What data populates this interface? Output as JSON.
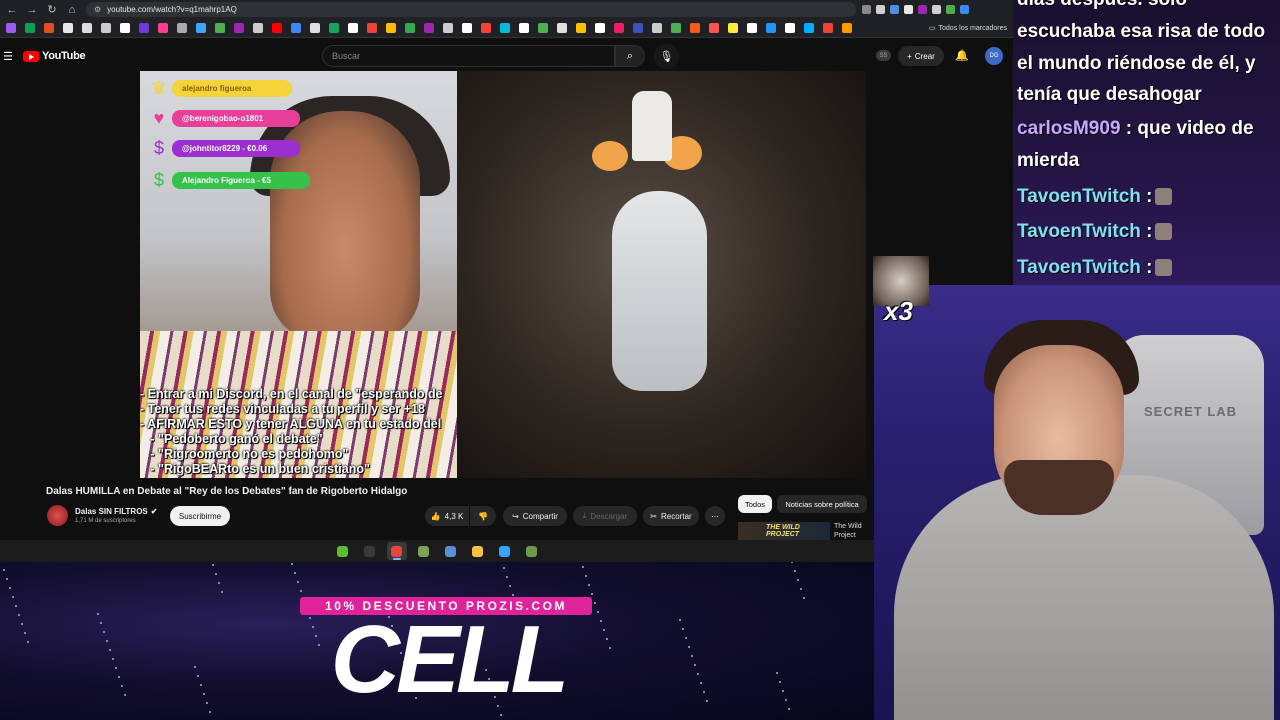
{
  "browser": {
    "url": "youtube.com/watch?v=q1mahrp1AQ",
    "bookmarks_all": "Todos los marcadores",
    "extension_colors": [
      "#8a8a8a",
      "#d0d0d0",
      "#4a90e2",
      "#e8e8e8",
      "#9c27b0",
      "#cfcfcf",
      "#4caf50",
      "#3c8cf0"
    ],
    "bookmark_colors": [
      "#9c5cf0",
      "#0f9d58",
      "#e34f26",
      "#e8e8e8",
      "#dddddd",
      "#cccccc",
      "#ffffff",
      "#6c3bd6",
      "#ff3d8e",
      "#aaaaaa",
      "#3ea6ff",
      "#4caf50",
      "#9c27b0",
      "#cccccc",
      "#ff0000",
      "#4285f4",
      "#e0e0e0",
      "#1aa260",
      "#ffffff",
      "#ea4335",
      "#fbbc05",
      "#34a853",
      "#9c27b0",
      "#cccccc",
      "#ffffff",
      "#f44336",
      "#00bcd4",
      "#ffffff",
      "#4caf50",
      "#e0e0e0",
      "#ffc107",
      "#ffffff",
      "#e91e63",
      "#3f51b5",
      "#cccccc",
      "#4caf50",
      "#ff5722",
      "#ff5252",
      "#ffeb3b",
      "#ffffff",
      "#2196f3",
      "#ffffff",
      "#00b0ff",
      "#ea4335",
      "#ff9800"
    ]
  },
  "youtube": {
    "logo_text": "YouTube",
    "search_placeholder": "Buscar",
    "ss_badge": "SS",
    "create_label": "Crear",
    "avatar_label": "DG"
  },
  "video": {
    "alerts": [
      {
        "text": "alejandro figueroa",
        "color": "#f5d43a",
        "icon": "crown-icon",
        "glyph": "♛",
        "text_color": "#8a5b00"
      },
      {
        "text": "@berenigobao-o1801",
        "color": "#e8409a",
        "icon": "heart-icon",
        "glyph": "♥",
        "text_color": "#ffffff"
      },
      {
        "text": "@johntitor8229 - €0.06",
        "color": "#9b2fd0",
        "icon": "coin-icon",
        "glyph": "$",
        "text_color": "#ffffff"
      },
      {
        "text": "Alejandro Figueroa - €5",
        "color": "#36c24a",
        "icon": "money-icon",
        "glyph": "$",
        "text_color": "#ffffff"
      }
    ],
    "overlay_text": "- Entrar a mi Discord, en el canal de \"esperando de\n- Tener tus redes vinculadas a tu perfil y ser +18\n- AFIRMAR ESTO y tener ALGUNA en tu estado del\n   - \"Pedoberto ganó el debate\"\n   - \"Rigroomerto no es pedohomo\"\n   - \"RigoBEARto es un buen cristiano\""
  },
  "info": {
    "title": "Dalas HUMILLA en Debate al \"Rey de los Debates\" fan de Rigoberto Hidalgo",
    "channel": "Dalas SIN FILTROS",
    "subscribers": "1,71 M de suscriptores",
    "subscribe": "Suscribirme",
    "likes": "4,3 K",
    "share": "Compartir",
    "download": "Descargar",
    "clip": "Recortar",
    "filters": [
      "Todos",
      "Noticias sobre política"
    ],
    "related_thumb_text": "THE WILD PROJECT",
    "related_title": "The Wild Project Santaolalla"
  },
  "taskbar": {
    "apps": [
      {
        "name": "taskbar-app-xbox",
        "color": "#5bbf2e",
        "active": false
      },
      {
        "name": "taskbar-app-obs",
        "color": "#3a3a3a",
        "active": false
      },
      {
        "name": "taskbar-app-chrome",
        "color": "#e8453c",
        "active": true
      },
      {
        "name": "taskbar-app-minecraft",
        "color": "#7da35b",
        "active": false
      },
      {
        "name": "taskbar-app-earth",
        "color": "#5a8fd6",
        "active": false
      },
      {
        "name": "taskbar-app-folder",
        "color": "#f5c242",
        "active": false
      },
      {
        "name": "taskbar-app-photoshop",
        "color": "#31a8ff",
        "active": false
      },
      {
        "name": "taskbar-app-minecraft-2",
        "color": "#6f9a4c",
        "active": false
      }
    ]
  },
  "promo": {
    "discount": "10% DESCUENTO PROZIS.COM",
    "product": "CELL"
  },
  "chat": {
    "lines": [
      {
        "user": "",
        "text": "días después. sólo"
      },
      {
        "user": "",
        "text": "escuchaba esa risa de todo"
      },
      {
        "user": "",
        "text": "el mundo riéndose de él, y"
      },
      {
        "user": "",
        "text": "tenía que desahogar"
      },
      {
        "user": "carlosM909",
        "text": " : que video de"
      },
      {
        "user": "",
        "text": "mierda"
      },
      {
        "user": "TavoenTwitch",
        "text": " :",
        "emote": true
      },
      {
        "user": "TavoenTwitch",
        "text": " :",
        "emote": true
      },
      {
        "user": "TavoenTwitch",
        "text": " :",
        "emote": true
      }
    ]
  },
  "streamer": {
    "chair_brand": "SECRET LAB",
    "multiplier": "x3"
  }
}
